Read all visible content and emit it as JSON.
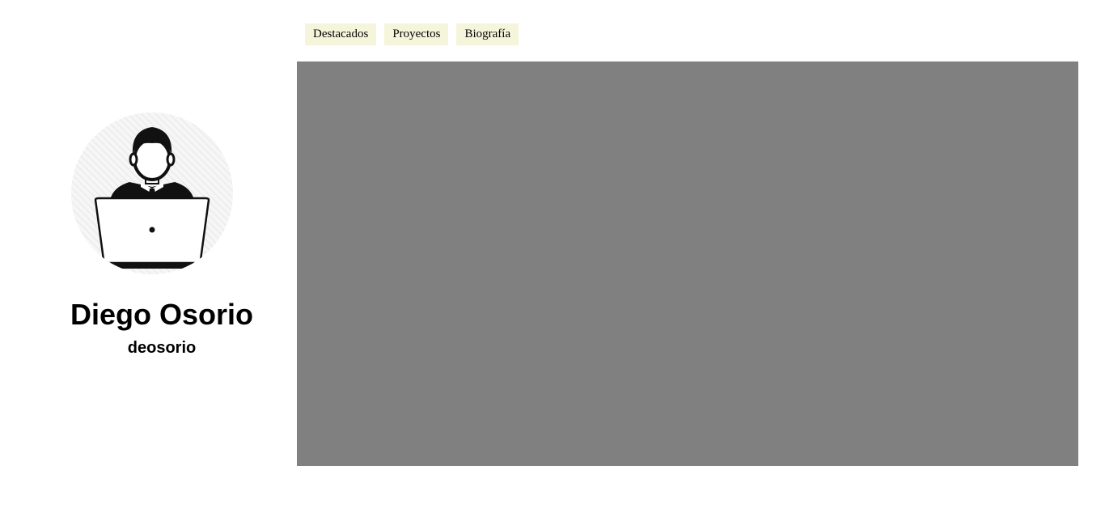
{
  "profile": {
    "name": "Diego Osorio",
    "username": "deosorio",
    "avatar_icon": "person-at-laptop-icon"
  },
  "tabs": [
    {
      "label": "Destacados"
    },
    {
      "label": "Proyectos"
    },
    {
      "label": "Biografía"
    }
  ],
  "colors": {
    "tab_background": "#f5f5dc",
    "content_background": "#808080",
    "page_background": "#ffffff"
  }
}
